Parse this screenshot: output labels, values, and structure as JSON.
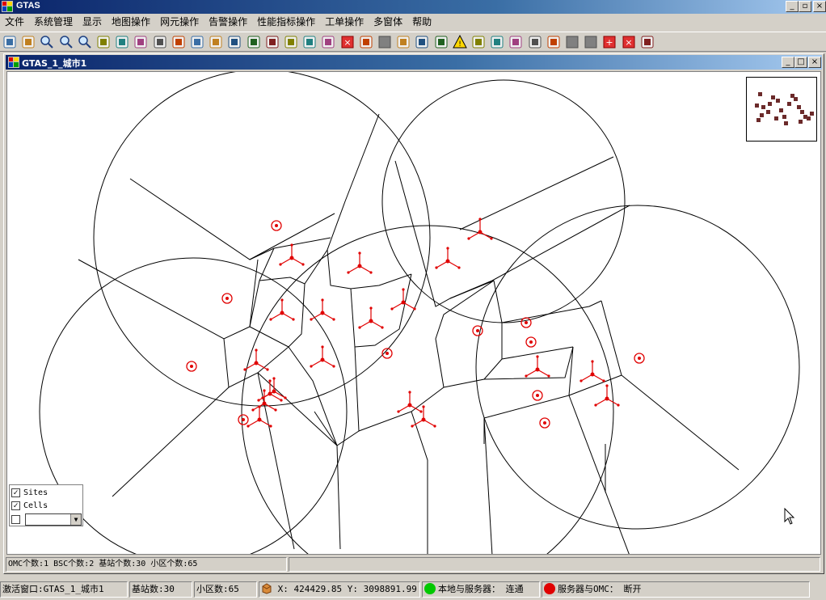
{
  "window": {
    "title": "GTAS",
    "btn_min": "_",
    "btn_restore": "▫",
    "btn_close": "×"
  },
  "menu": [
    "文件",
    "系统管理",
    "显示",
    "地图操作",
    "网元操作",
    "告警操作",
    "性能指标操作",
    "工单操作",
    "多窗体",
    "帮助"
  ],
  "toolbar_icons": [
    "select-icon",
    "pan-hand-icon",
    "zoom-icon",
    "zoom-in-icon",
    "zoom-out-icon",
    "tool-icon",
    "refresh-icon",
    "map-icon",
    "anchor-icon",
    "binoculars-icon",
    "clipboard-icon",
    "shapes-icon",
    "layers-icon",
    "edit-icon",
    "pin-icon",
    "b-icon",
    "c-icon",
    "t-icon",
    "stop-icon",
    "layer-icon",
    "gray-circle-icon",
    "fm-icon",
    "print-icon",
    "cube-icon",
    "warning-icon",
    "network-icon",
    "check-icon",
    "clock-icon",
    "disc-icon",
    "chart-icon",
    "gray-box-icon",
    "gray-square-icon",
    "red-plus-icon",
    "red-x-icon",
    "windows-icon"
  ],
  "child": {
    "title": "GTAS_1_城市1",
    "btn_min": "_",
    "btn_restore": "□",
    "btn_close": "×",
    "legend": {
      "sites_label": "Sites",
      "cells_label": "Cells",
      "sites_checked": "✓",
      "cells_checked": "✓",
      "combo_arrow": "▼"
    },
    "status": "OMC个数:1  BSC个数:2  基站个数:30  小区个数:65"
  },
  "statusbar": {
    "active_window": "激活窗口:GTAS_1_城市1",
    "site_count": "基站数:30",
    "cell_count": "小区数:65",
    "coords": "X: 424429.85   Y: 3098891.99",
    "local_server": "本地与服务器：  连通",
    "server_omc": "服务器与OMC：  断开",
    "local_server_color": "#00c800",
    "server_omc_color": "#e00000"
  },
  "colors": {
    "site_red": "#e00000",
    "title_blue": "#0a246a"
  }
}
